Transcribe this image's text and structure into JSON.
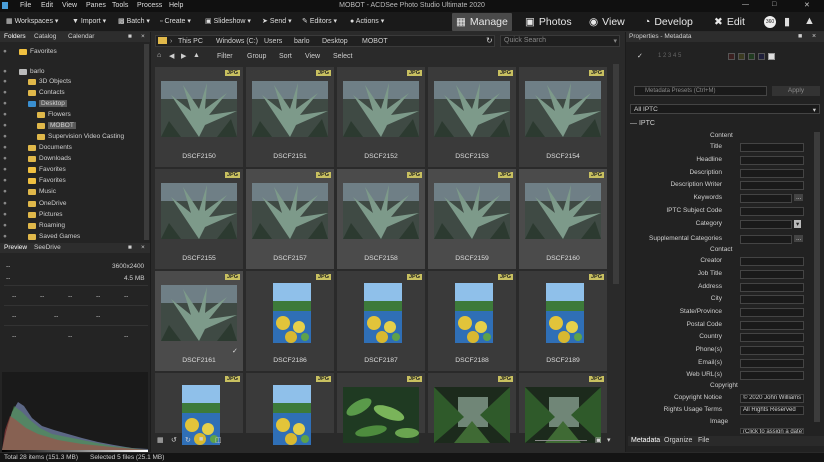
{
  "window": {
    "title": "MOBOT - ACDSee Photo Studio Ultimate 2020"
  },
  "menu": [
    "File",
    "Edit",
    "View",
    "Panes",
    "Tools",
    "Process",
    "Help"
  ],
  "toolbar": {
    "items": [
      "Workspaces",
      "Import",
      "Batch",
      "Create",
      "Slideshow",
      "Send",
      "Editors",
      "Actions"
    ],
    "modes": [
      "Manage",
      "Photos",
      "View",
      "Develop",
      "Edit"
    ],
    "active_mode": "Manage"
  },
  "left_tabs": [
    "Folders",
    "Catalog",
    "Calendar"
  ],
  "tree": [
    {
      "label": "Favorites",
      "depth": 1,
      "icon": "star-icon",
      "selected": false
    },
    {
      "label": "barlo",
      "depth": 1,
      "icon": "user-icon",
      "selected": false
    },
    {
      "label": "3D Objects",
      "depth": 2,
      "icon": "folder-icon",
      "selected": false
    },
    {
      "label": "Contacts",
      "depth": 2,
      "icon": "folder-icon",
      "selected": false
    },
    {
      "label": "Desktop",
      "depth": 2,
      "icon": "folder-icon",
      "selected": true
    },
    {
      "label": "Flowers",
      "depth": 3,
      "icon": "folder-icon",
      "selected": false
    },
    {
      "label": "MOBOT",
      "depth": 3,
      "icon": "folder-icon",
      "selected": true
    },
    {
      "label": "Supervision Video Casting",
      "depth": 3,
      "icon": "folder-icon",
      "selected": false
    },
    {
      "label": "Documents",
      "depth": 2,
      "icon": "folder-icon",
      "selected": false
    },
    {
      "label": "Downloads",
      "depth": 2,
      "icon": "folder-icon",
      "selected": false
    },
    {
      "label": "Favorites",
      "depth": 2,
      "icon": "star-icon",
      "selected": false
    },
    {
      "label": "Favorites",
      "depth": 2,
      "icon": "star-icon",
      "selected": false
    },
    {
      "label": "Music",
      "depth": 2,
      "icon": "folder-icon",
      "selected": false
    },
    {
      "label": "OneDrive",
      "depth": 2,
      "icon": "folder-icon",
      "selected": false
    },
    {
      "label": "Pictures",
      "depth": 2,
      "icon": "folder-icon",
      "selected": false
    },
    {
      "label": "Roaming",
      "depth": 2,
      "icon": "folder-icon",
      "selected": false
    },
    {
      "label": "Saved Games",
      "depth": 2,
      "icon": "folder-icon",
      "selected": false
    }
  ],
  "preview": {
    "tabs": [
      "Preview",
      "SeeDrive"
    ],
    "dimensions": "3600x2400",
    "size": "4.5 MB",
    "placeholder": "--"
  },
  "address": {
    "path": [
      "This PC",
      "Windows (C:)",
      "Users",
      "barlo",
      "Desktop",
      "MOBOT"
    ],
    "search_placeholder": "Quick Search"
  },
  "filterbar": [
    "Filter",
    "Group",
    "Sort",
    "View",
    "Select"
  ],
  "thumbnails": [
    {
      "name": "DSCF2150",
      "kind": "agave",
      "selected": false
    },
    {
      "name": "DSCF2151",
      "kind": "agave",
      "selected": false
    },
    {
      "name": "DSCF2152",
      "kind": "agave",
      "selected": false
    },
    {
      "name": "DSCF2153",
      "kind": "agave",
      "selected": false
    },
    {
      "name": "DSCF2154",
      "kind": "agave",
      "selected": false
    },
    {
      "name": "DSCF2155",
      "kind": "agave",
      "selected": false
    },
    {
      "name": "DSCF2157",
      "kind": "agave",
      "selected": true
    },
    {
      "name": "DSCF2158",
      "kind": "agave",
      "selected": true
    },
    {
      "name": "DSCF2159",
      "kind": "agave",
      "selected": true
    },
    {
      "name": "DSCF2160",
      "kind": "agave",
      "selected": true
    },
    {
      "name": "DSCF2161",
      "kind": "agave",
      "selected": true
    },
    {
      "name": "DSCF2186",
      "kind": "pond",
      "selected": false
    },
    {
      "name": "DSCF2187",
      "kind": "pond",
      "selected": false
    },
    {
      "name": "DSCF2188",
      "kind": "pond",
      "selected": false
    },
    {
      "name": "DSCF2189",
      "kind": "pond",
      "selected": false
    },
    {
      "name": "",
      "kind": "pond",
      "selected": false
    },
    {
      "name": "",
      "kind": "pond",
      "selected": false
    },
    {
      "name": "",
      "kind": "leaves",
      "selected": false
    },
    {
      "name": "",
      "kind": "jungle",
      "selected": false
    },
    {
      "name": "",
      "kind": "jungle",
      "selected": false
    }
  ],
  "badge": "JPG",
  "properties": {
    "title": "Properties - Metadata",
    "presets": "Metadata Presets (Ctrl+M)",
    "apply": "Apply",
    "view": "All IPTC",
    "section": "IPTC",
    "groups": [
      "Content",
      "Contact",
      "Copyright",
      "Image"
    ],
    "fields": [
      "Title",
      "Headline",
      "Description",
      "Description Writer",
      "Keywords",
      "IPTC Subject Code",
      "Category",
      "Supplemental Categories",
      "Creator",
      "Job Title",
      "Address",
      "City",
      "State/Province",
      "Postal Code",
      "Country",
      "Phone(s)",
      "Email(s)",
      "Web URL(s)",
      "Copyright Notice",
      "Rights Usage Terms"
    ],
    "copyright_notice": "© 2020 John Williams",
    "rights_usage": "All Rights Reserved",
    "date_placeholder": "(Click to assign a date)",
    "tabs": [
      "Metadata",
      "Organize",
      "File"
    ]
  },
  "status": {
    "total": "Total 28 items  (151.3 MB)",
    "selected": "Selected 5 files (25.1 MB)"
  },
  "colors": {
    "accent": "#c8c060",
    "selection": "#1f6fb2",
    "folder": "#e0b84a"
  }
}
